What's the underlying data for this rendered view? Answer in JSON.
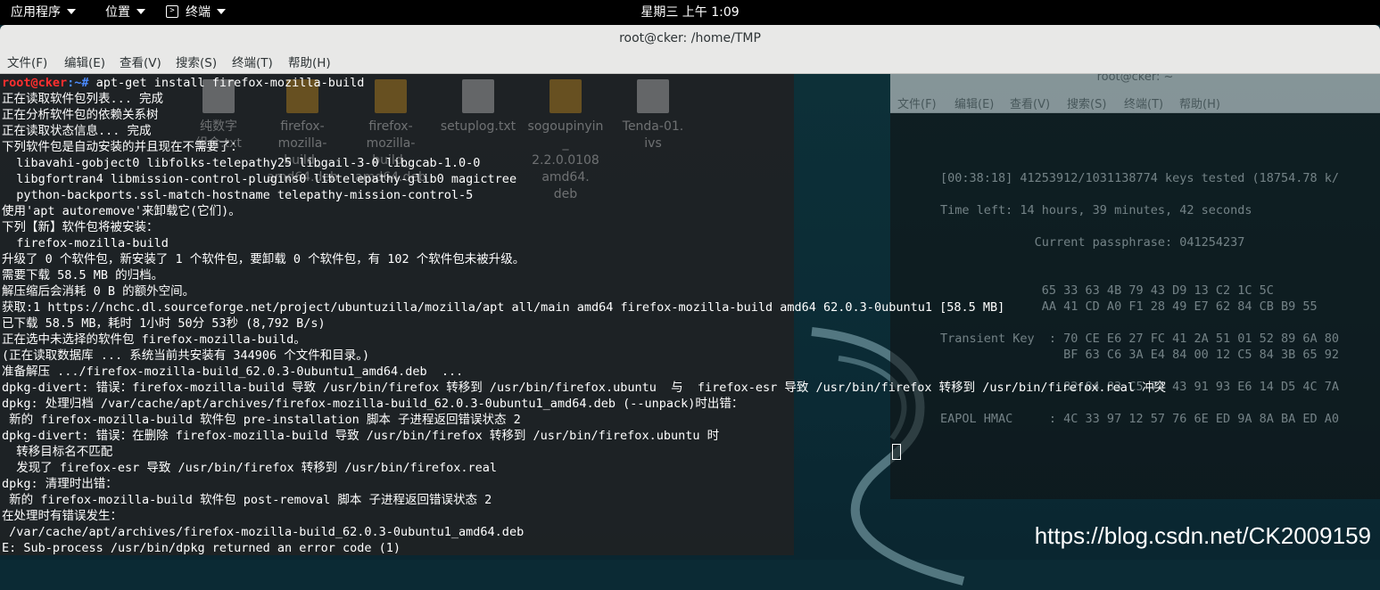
{
  "topbar": {
    "applications": "应用程序",
    "places": "位置",
    "terminal_menu": "终端",
    "clock": "星期三 上午 1:09"
  },
  "window": {
    "title": "root@cker: /home/TMP",
    "menus": [
      "文件(F)",
      "编辑(E)",
      "查看(V)",
      "搜索(S)",
      "终端(T)",
      "帮助(H)"
    ]
  },
  "background_window": {
    "title": "root@cker: ~",
    "menus": [
      "文件(F)",
      "编辑(E)",
      "查看(V)",
      "搜索(S)",
      "终端(T)",
      "帮助(H)"
    ],
    "lines": [
      "[00:38:18] 41253912/1031138774 keys tested (18754.78 k/",
      "Time left: 14 hours, 39 minutes, 42 seconds",
      "             Current passphrase: 041254237",
      "              65 33 63 4B 79 43 D9 13 C2 1C 5C",
      "              AA 41 CD A0 F1 28 49 E7 62 84 CB B9 55",
      "Transient Key  : 70 CE E6 27 FC 41 2A 51 01 52 89 6A 80",
      "                 BF 63 C6 3A E4 84 00 12 C5 84 3B 65 92",
      "                 82 84 83 C5 74 43 91 93 E6 14 D5 4C 7A",
      "EAPOL HMAC     : 4C 33 97 12 57 76 6E ED 9A 8A BA ED A0"
    ]
  },
  "desktop_icons": [
    {
      "label": "纯数字\n组合.txt"
    },
    {
      "label": "firefox-\nmozilla-\nbuild_\namd64.deb"
    },
    {
      "label": "firefox-\nmozilla-\nbuild_\namd64.deb"
    },
    {
      "label": "setuplog.txt"
    },
    {
      "label": "sogoupinyin\n_\n2.2.0.0108\namd64.\ndeb"
    },
    {
      "label": "Tenda-01.\nivs"
    }
  ],
  "terminal": {
    "prompt_user": "root@cker",
    "prompt_path": ":~# ",
    "command": "apt-get install firefox-mozilla-build",
    "lines": [
      "正在读取软件包列表... 完成",
      "正在分析软件包的依赖关系树",
      "正在读取状态信息... 完成",
      "下列软件包是自动安装的并且现在不需要了：",
      "  libavahi-gobject0 libfolks-telepathy25 libgail-3-0 libgcab-1.0-0",
      "  libgfortran4 libmission-control-plugins0 libtelepathy-glib0 magictree",
      "  python-backports.ssl-match-hostname telepathy-mission-control-5",
      "使用'apt autoremove'来卸载它(它们)。",
      "下列【新】软件包将被安装：",
      "  firefox-mozilla-build",
      "升级了 0 个软件包，新安装了 1 个软件包，要卸载 0 个软件包，有 102 个软件包未被升级。",
      "需要下载 58.5 MB 的归档。",
      "解压缩后会消耗 0 B 的额外空间。",
      "获取:1 https://nchc.dl.sourceforge.net/project/ubuntuzilla/mozilla/apt all/main amd64 firefox-mozilla-build amd64 62.0.3-0ubuntu1 [58.5 MB]",
      "已下载 58.5 MB，耗时 1小时 50分 53秒 (8,792 B/s)",
      "正在选中未选择的软件包 firefox-mozilla-build。",
      "(正在读取数据库 ... 系统当前共安装有 344906 个文件和目录。)",
      "准备解压 .../firefox-mozilla-build_62.0.3-0ubuntu1_amd64.deb  ...",
      "dpkg-divert: 错误：firefox-mozilla-build 导致 /usr/bin/firefox 转移到 /usr/bin/firefox.ubuntu  与  firefox-esr 导致 /usr/bin/firefox 转移到 /usr/bin/firefox.real 冲突",
      "dpkg: 处理归档 /var/cache/apt/archives/firefox-mozilla-build_62.0.3-0ubuntu1_amd64.deb (--unpack)时出错：",
      " 新的 firefox-mozilla-build 软件包 pre-installation 脚本 子进程返回错误状态 2",
      "dpkg-divert: 错误：在删除 firefox-mozilla-build 导致 /usr/bin/firefox 转移到 /usr/bin/firefox.ubuntu 时",
      "  转移目标名不匹配",
      "  发现了 firefox-esr 导致 /usr/bin/firefox 转移到 /usr/bin/firefox.real",
      "dpkg: 清理时出错：",
      " 新的 firefox-mozilla-build 软件包 post-removal 脚本 子进程返回错误状态 2",
      "在处理时有错误发生：",
      " /var/cache/apt/archives/firefox-mozilla-build_62.0.3-0ubuntu1_amd64.deb",
      "E: Sub-process /usr/bin/dpkg returned an error code (1)"
    ]
  },
  "watermark": "https://blog.csdn.net/CK2009159"
}
